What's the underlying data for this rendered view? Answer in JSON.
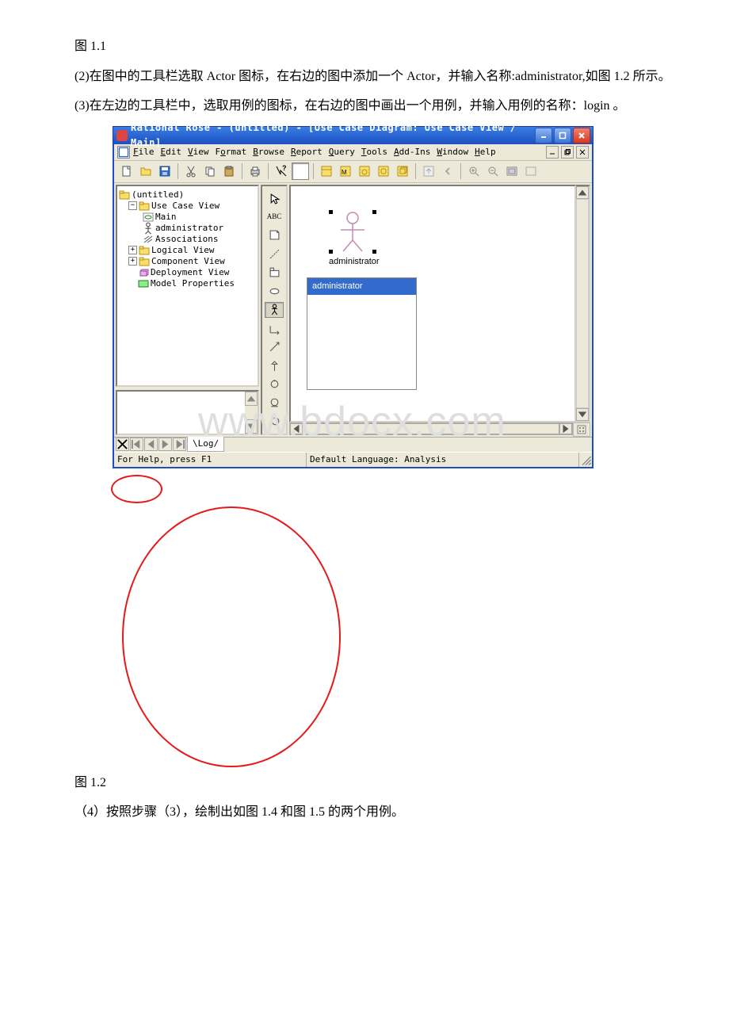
{
  "para1": "图 1.1",
  "para2": "(2)在图中的工具栏选取 Actor 图标，在右边的图中添加一个 Actor，并输入名称:administrator,如图 1.2 所示。",
  "para3": "(3)在左边的工具栏中，选取用例的图标，在右边的图中画出一个用例，并输入用例的名称：login 。",
  "para_fig2": "图 1.2",
  "para4": "（4）按照步骤（3），绘制出如图 1.4 和图 1.5 的两个用例。",
  "screenshot": {
    "title": "Rational Rose - (untitled) - [Use Case Diagram: Use Case View / Main]",
    "menu": {
      "file": "File",
      "edit": "Edit",
      "view": "View",
      "format": "Format",
      "browse": "Browse",
      "report": "Report",
      "query": "Query",
      "tools": "Tools",
      "addins": "Add-Ins",
      "window": "Window",
      "help": "Help"
    },
    "tree": {
      "root": "(untitled)",
      "items": [
        "Use Case View",
        "Main",
        "administrator",
        "Associations",
        "Logical View",
        "Component View",
        "Deployment View",
        "Model Properties"
      ]
    },
    "toolbox": {
      "abc": "ABC"
    },
    "canvas": {
      "actor_label": "administrator",
      "selected_label": "administrator"
    },
    "logtab": "Log",
    "status": {
      "help": "For Help, press F1",
      "lang": "Default Language: Analysis"
    }
  },
  "watermark": "www.bdocx.com"
}
